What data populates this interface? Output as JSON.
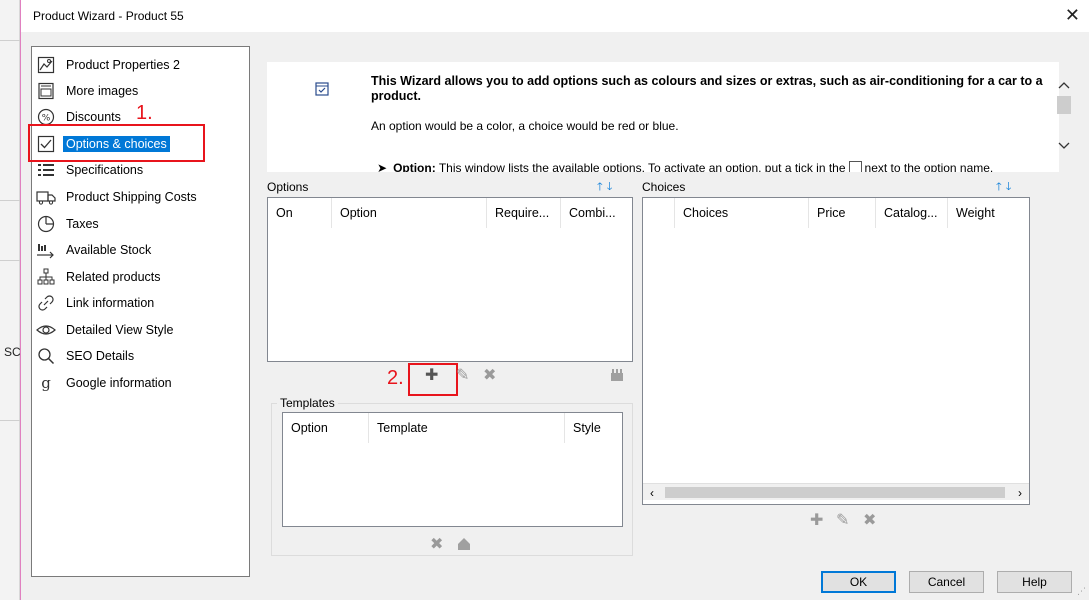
{
  "background": {
    "partial_text": "SC"
  },
  "dialog": {
    "title": "Product Wizard - Product 55",
    "close_glyph": "✕",
    "accent_color": "#0078d7",
    "annotation_color": "#e8141c"
  },
  "nav": {
    "items": [
      {
        "label": "Product Properties 2",
        "icon": "image-icon"
      },
      {
        "label": "More images",
        "icon": "gallery-icon"
      },
      {
        "label": "Discounts",
        "icon": "percent-icon"
      },
      {
        "label": "Options & choices",
        "icon": "checkbox-icon",
        "selected": true
      },
      {
        "label": "Specifications",
        "icon": "list-icon"
      },
      {
        "label": "Product Shipping Costs",
        "icon": "truck-icon"
      },
      {
        "label": "Taxes",
        "icon": "pie-chart-icon"
      },
      {
        "label": "Available Stock",
        "icon": "stock-icon"
      },
      {
        "label": "Related products",
        "icon": "hierarchy-icon"
      },
      {
        "label": "Link information",
        "icon": "link-icon"
      },
      {
        "label": "Detailed View Style",
        "icon": "eye-icon"
      },
      {
        "label": "SEO Details",
        "icon": "search-icon"
      },
      {
        "label": "Google information",
        "icon": "google-icon"
      }
    ]
  },
  "annotations": {
    "step1": "1.",
    "step2": "2."
  },
  "info": {
    "heading": "This Wizard allows you to add options such as colours and sizes or extras, such as air-conditioning for a car to a product.",
    "subtext": "An option would be a color, a choice would be red or blue.",
    "option_bold": "Option:",
    "option_text": " This window lists the available options. To activate an option, put a tick in the",
    "option_tail": "next to the option name."
  },
  "options": {
    "section_label": "Options",
    "columns": [
      "On",
      "Option",
      "Require...",
      "Combi..."
    ]
  },
  "choices": {
    "section_label": "Choices",
    "columns": [
      "Choices",
      "Price",
      "Catalog...",
      "Weight"
    ]
  },
  "templates": {
    "section_label": "Templates",
    "columns": [
      "Option",
      "Template",
      "Style"
    ]
  },
  "buttons": {
    "ok": "OK",
    "cancel": "Cancel",
    "help": "Help"
  }
}
